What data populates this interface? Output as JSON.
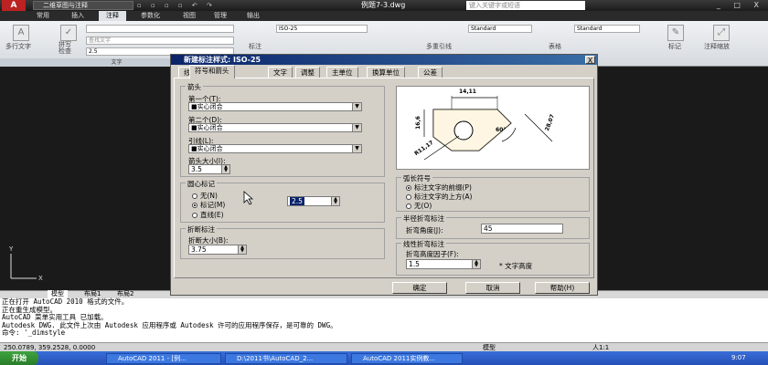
{
  "titlebar": {
    "app_logo": "A",
    "workspace": "二维草图与注释",
    "document": "例题7-3.dwg",
    "search_placeholder": "键入关键字或短语",
    "controls": "_ □ X"
  },
  "ribbon_tabs": [
    "常用",
    "插入",
    "注释",
    "参数化",
    "视图",
    "管理",
    "输出"
  ],
  "active_tab_index": 2,
  "ribbon": {
    "multiline_text": "多行文字",
    "spell_check": "拼写\n检查",
    "find_text": "查找文字",
    "text_height": "2.5",
    "style_label": "标注",
    "iso_label": "ISO-25",
    "text_footer": "文字",
    "mleader": "多重引线",
    "standard1": "Standard",
    "table": "表格",
    "standard2": "Standard",
    "markup": "标记",
    "annoscale": "注释缩放"
  },
  "layout_tabs": [
    "模型",
    "布局1",
    "布局2"
  ],
  "command_lines": [
    "正在打开 AutoCAD 2010 格式的文件。",
    "正在重生成模型。",
    "AutoCAD 菜单实用工具 已加载。",
    "Autodesk DWG.   此文件上次由 Autodesk 应用程序或 Autodesk 许可的应用程序保存，是可靠的 DWG。",
    "命令: '_dimstyle"
  ],
  "status": {
    "coords": "250.0789,  359.2528, 0.0000",
    "model": "模型",
    "scale": "人1:1",
    "time": "9:07"
  },
  "taskbar": {
    "start": "开始",
    "tasks": [
      "AutoCAD 2011 - [例...",
      "D:\\2011书\\AutoCAD_2...",
      "AutoCAD 2011实例教..."
    ]
  },
  "dialog": {
    "title": "新建标注样式: ISO-25",
    "close": "X",
    "tabs": [
      "线",
      "符号和箭头",
      "文字",
      "调整",
      "主单位",
      "换算单位",
      "公差"
    ],
    "active_tab_index": 1,
    "arrowheads": {
      "group": "箭头",
      "first_label": "第一个(T):",
      "first_value": "■实心闭合",
      "second_label": "第二个(D):",
      "second_value": "■实心闭合",
      "leader_label": "引线(L):",
      "leader_value": "■实心闭合",
      "size_label": "箭头大小(I):",
      "size_value": "3.5"
    },
    "center_marks": {
      "group": "圆心标记",
      "options": [
        "无(N)",
        "标记(M)",
        "直线(E)"
      ],
      "selected": 1,
      "size_value": "2.5"
    },
    "dim_break": {
      "group": "折断标注",
      "size_label": "折断大小(B):",
      "size_value": "3.75"
    },
    "arc_length": {
      "group": "弧长符号",
      "options": [
        "标注文字的前缀(P)",
        "标注文字的上方(A)",
        "无(O)"
      ],
      "selected": 0
    },
    "radius_jog": {
      "group": "半径折弯标注",
      "angle_label": "折弯角度(J):",
      "angle_value": "45"
    },
    "linear_jog": {
      "group": "线性折弯标注",
      "factor_label": "折弯高度因子(F):",
      "factor_value": "1.5",
      "unit": "* 文字高度"
    },
    "preview": {
      "dim_top": "14,11",
      "dim_left": "16,6",
      "dim_right": "28,07",
      "dim_angle": "60°",
      "dim_radius": "R11,17"
    },
    "buttons": {
      "ok": "确定",
      "cancel": "取消",
      "help": "帮助(H)"
    }
  }
}
